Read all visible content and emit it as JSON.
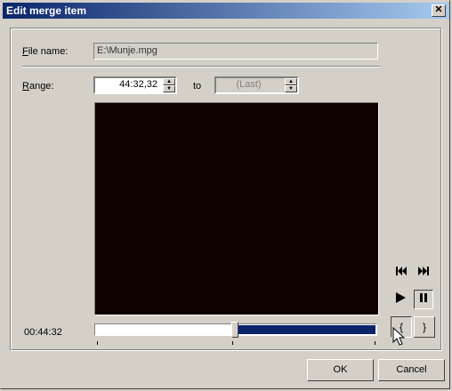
{
  "window": {
    "title": "Edit merge item",
    "close_glyph": "✕"
  },
  "file": {
    "label_prefix": "F",
    "label_rest": "ile name:",
    "value": "E:\\Munje.mpg"
  },
  "range": {
    "label_prefix": "R",
    "label_rest": "ange:",
    "from_value": "44:32,32",
    "to_label": "to",
    "to_value": "(Last)"
  },
  "player": {
    "time": "00:44:32",
    "position_fraction": 0.5,
    "controls": {
      "prev_icon": "skip-previous-icon",
      "next_icon": "skip-next-icon",
      "play_icon": "play-icon",
      "pause_icon": "pause-icon",
      "mark_in_label": "{",
      "mark_out_label": "}"
    }
  },
  "buttons": {
    "ok": "OK",
    "cancel": "Cancel"
  }
}
